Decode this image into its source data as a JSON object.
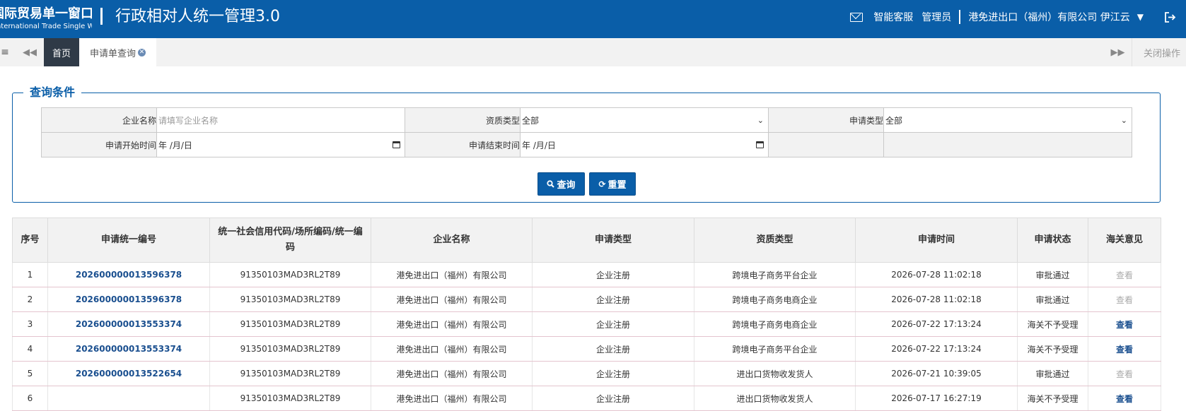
{
  "header": {
    "brand_cn": "国际贸易单一窗口",
    "brand_en": "International Trade Single Window",
    "app_title": "行政相对人统一管理3.0",
    "service_label": "智能客服",
    "role_label": "管理员",
    "company_user": "港免进出口（福州）有限公司 伊江云"
  },
  "tabs": {
    "home_label": "首页",
    "active_label": "申请单查询",
    "close_ops_label": "关闭操作"
  },
  "query": {
    "legend": "查询条件",
    "company_name_label": "企业名称",
    "company_name_placeholder": "请填写企业名称",
    "qual_type_label": "资质类型",
    "qual_type_value": "全部",
    "apply_type_label": "申请类型",
    "apply_type_value": "全部",
    "start_time_label": "申请开始时间",
    "start_time_value": "年 /月/日",
    "end_time_label": "申请结束时间",
    "end_time_value": "年 /月/日",
    "search_button": "查询",
    "reset_button": "重置"
  },
  "results": {
    "columns": {
      "seq": "序号",
      "app_no": "申请统一编号",
      "credit_code_line1": "统一社会信用代码/场所编码/统一编",
      "credit_code_line2": "码",
      "company": "企业名称",
      "apply_type": "申请类型",
      "qual_type": "资质类型",
      "apply_time": "申请时间",
      "status": "申请状态",
      "opinion": "海关意见"
    },
    "rows": [
      {
        "seq": "1",
        "app_no": "202600000013596378",
        "code": "91350103MAD3RL2T89",
        "company": "港免进出口（福州）有限公司",
        "apply_type": "企业注册",
        "qual_type": "跨境电子商务平台企业",
        "time": "2026-07-28 11:02:18",
        "status": "审批通过",
        "opinion": "查看"
      },
      {
        "seq": "2",
        "app_no": "202600000013596378",
        "code": "91350103MAD3RL2T89",
        "company": "港免进出口（福州）有限公司",
        "apply_type": "企业注册",
        "qual_type": "跨境电子商务电商企业",
        "time": "2026-07-28 11:02:18",
        "status": "审批通过",
        "opinion": "查看"
      },
      {
        "seq": "3",
        "app_no": "202600000013553374",
        "code": "91350103MAD3RL2T89",
        "company": "港免进出口（福州）有限公司",
        "apply_type": "企业注册",
        "qual_type": "跨境电子商务电商企业",
        "time": "2026-07-22 17:13:24",
        "status": "海关不予受理",
        "opinion": "查看"
      },
      {
        "seq": "4",
        "app_no": "202600000013553374",
        "code": "91350103MAD3RL2T89",
        "company": "港免进出口（福州）有限公司",
        "apply_type": "企业注册",
        "qual_type": "跨境电子商务平台企业",
        "time": "2026-07-22 17:13:24",
        "status": "海关不予受理",
        "opinion": "查看"
      },
      {
        "seq": "5",
        "app_no": "202600000013522654",
        "code": "91350103MAD3RL2T89",
        "company": "港免进出口（福州）有限公司",
        "apply_type": "企业注册",
        "qual_type": "进出口货物收发货人",
        "time": "2026-07-21 10:39:05",
        "status": "审批通过",
        "opinion": "查看"
      },
      {
        "seq": "6",
        "app_no": "",
        "code": "91350103MAD3RL2T89",
        "company": "港免进出口（福州）有限公司",
        "apply_type": "企业注册",
        "qual_type": "进出口货物收发货人",
        "time": "2026-07-17 16:27:19",
        "status": "海关不予受理",
        "opinion": "查看"
      }
    ]
  }
}
